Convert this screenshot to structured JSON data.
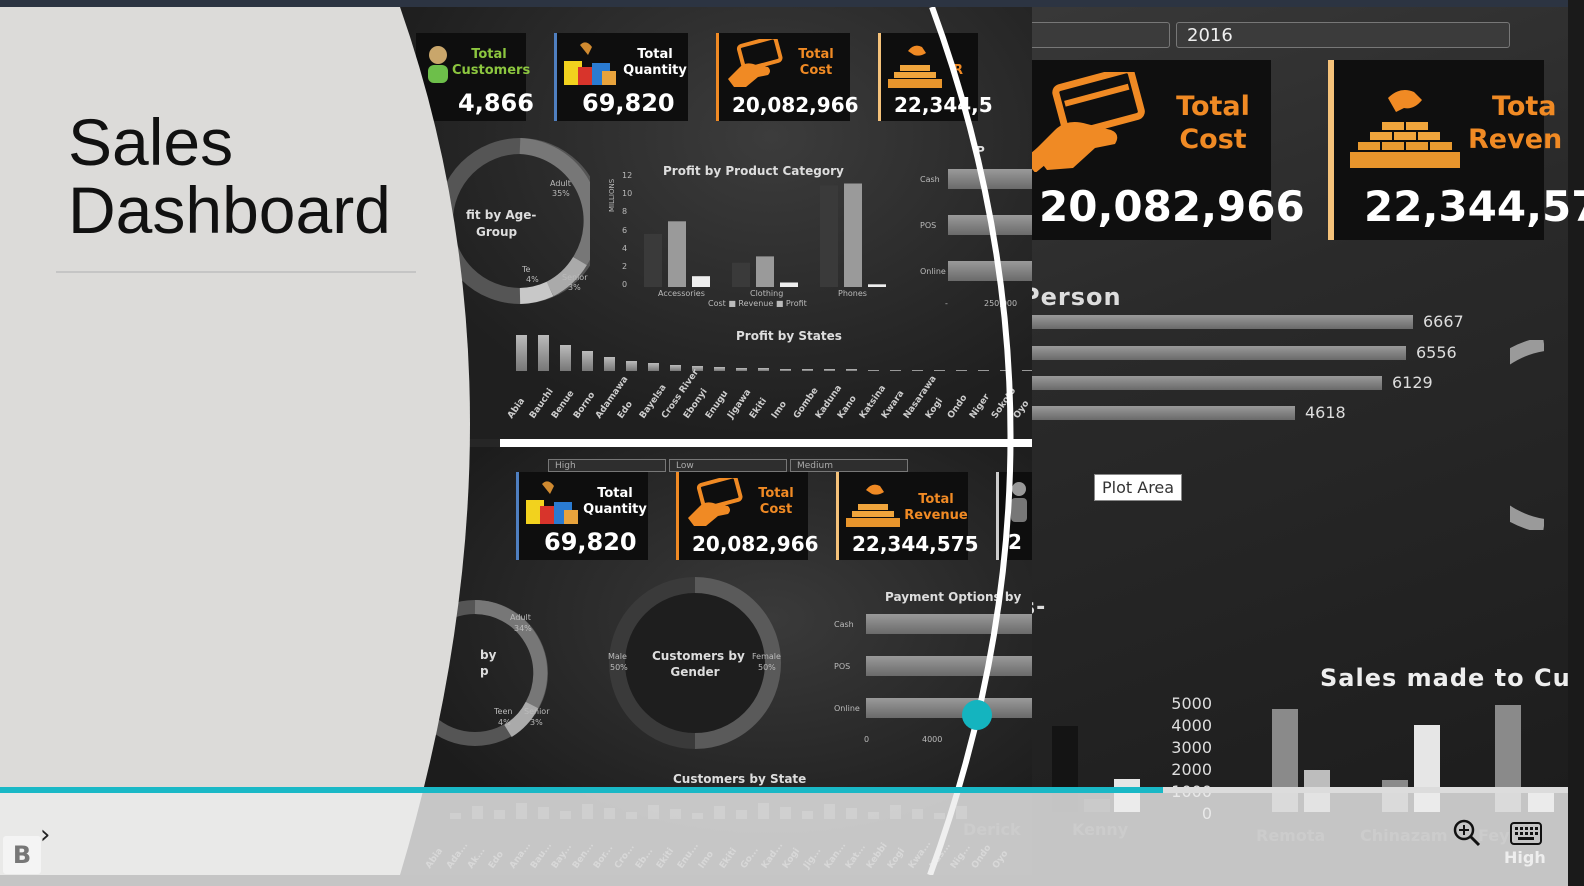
{
  "slide": {
    "title_line1": "Sales",
    "title_line2": "Dashboard"
  },
  "right": {
    "slicer_year": "2016",
    "kpis": [
      {
        "title": [
          "Total",
          "Cost"
        ],
        "value": "20,082,966"
      },
      {
        "title": [
          "Tota",
          "Reven"
        ],
        "value": "22,344,57"
      }
    ],
    "salesperson_title": "Person",
    "salesperson_bars": [
      {
        "value": "6667",
        "frac": 1.0
      },
      {
        "value": "6556",
        "frac": 0.983
      },
      {
        "value": "6129",
        "frac": 0.919
      },
      {
        "value": "4618",
        "frac": 0.693
      }
    ],
    "tooltip": "Plot Area",
    "partial_label": "s-",
    "sales_title": "Sales made to Cu",
    "yticks": [
      "5000",
      "4000",
      "3000",
      "2000",
      "1000",
      "0"
    ],
    "names": [
      "Derick",
      "Kenny",
      "Remota",
      "Chinazam",
      "Feyi"
    ],
    "bottom_word": "High"
  },
  "mid_top": {
    "kpis": [
      {
        "title": [
          "Total",
          "Customers"
        ],
        "value": "4,866"
      },
      {
        "title": [
          "Total",
          "Quantity"
        ],
        "value": "69,820"
      },
      {
        "title": [
          "Total",
          "Cost"
        ],
        "value": "20,082,966"
      },
      {
        "title": [
          "R",
          ""
        ],
        "value": "22,344,5"
      }
    ],
    "age_chart_title": [
      "fit by Age-",
      "Group"
    ],
    "age_labels": [
      "Adult",
      "35%",
      "Te",
      "4%",
      "Senior",
      "3%"
    ],
    "product_title": "Profit by Product Category",
    "product_unit": "MILLIONS",
    "product_yticks": [
      "12",
      "10",
      "8",
      "6",
      "4",
      "2",
      "0"
    ],
    "product_categories": [
      "Accessories",
      "Clothing",
      "Phones"
    ],
    "product_legend": "Cost  ■ Revenue  ■ Profit",
    "payment_partial_title": "P",
    "payment_labels": [
      "Cash",
      "POS",
      "Online"
    ],
    "payment_xticks": [
      "-",
      "250,000"
    ],
    "states_title": "Profit by States",
    "states": [
      "Abia",
      "Bauchi",
      "Benue",
      "Borno",
      "Adamawa",
      "Edo",
      "Bayelsa",
      "Cross River",
      "Ebonyi",
      "Enugu",
      "Jigawa",
      "Ekiti",
      "Imo",
      "Gombe",
      "Kaduna",
      "Kano",
      "Katsina",
      "Kwara",
      "Nasarawa",
      "Kogi",
      "Ondo",
      "Niger",
      "Sokoto",
      "Oyo"
    ]
  },
  "mid_bot": {
    "slicers": [
      "High",
      "Low",
      "Medium"
    ],
    "kpis": [
      {
        "title": [
          "Total",
          "Quantity"
        ],
        "value": "69,820"
      },
      {
        "title": [
          "Total",
          "Cost"
        ],
        "value": "20,082,966"
      },
      {
        "title": [
          "Total",
          "Revenue"
        ],
        "value": "22,344,575"
      },
      {
        "title": [
          "",
          ""
        ],
        "value": "2"
      }
    ],
    "age_partial": [
      "by",
      "p"
    ],
    "age_labels": [
      "Adult",
      "34%",
      "Teen",
      "4%",
      "Senior",
      "3%"
    ],
    "gender_title": [
      "Customers by",
      "Gender"
    ],
    "gender_labels": [
      "Male",
      "50%",
      "Female",
      "50%"
    ],
    "payment_title": "Payment Options by",
    "payment_labels": [
      "Cash",
      "POS",
      "Online"
    ],
    "payment_xticks": [
      "0",
      "4000"
    ],
    "state_title": "Customers by State",
    "states": [
      "Abia",
      "Ada...",
      "Ak...",
      "Edo",
      "Ana...",
      "Bau...",
      "Bay...",
      "Ben...",
      "Bor...",
      "Cro...",
      "Eb...",
      "Ekiti",
      "Enu...",
      "Imo",
      "Ekiti",
      "Go...",
      "Kad...",
      "Kogi",
      "Jig...",
      "Kan...",
      "Kat...",
      "Kebbi",
      "Kogi",
      "Kwa...",
      "Nas...",
      "Nig...",
      "Ondo",
      "Oyo"
    ]
  }
}
